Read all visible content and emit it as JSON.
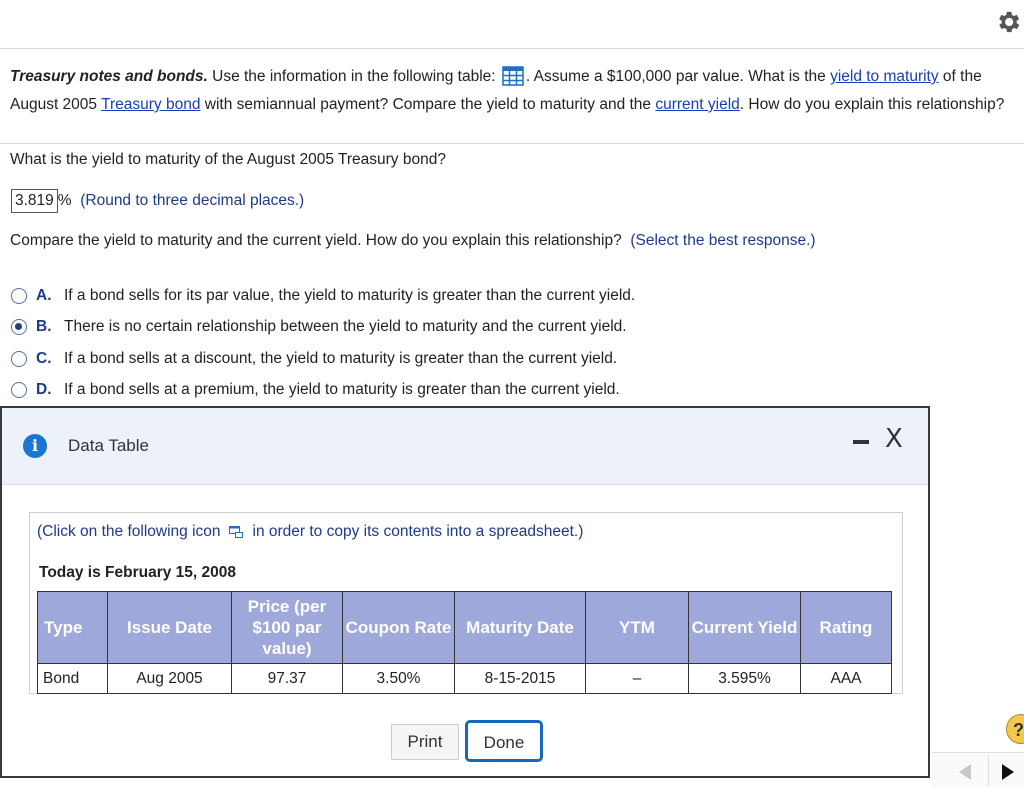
{
  "question": {
    "title": "Treasury notes and bonds.",
    "p1": " Use the information in the following table: ",
    "p2": ". Assume a $100,000 par value. What is the ",
    "link_ytm": "yield to maturity",
    "p3": " of the August 2005 ",
    "link_tbond": "Treasury bond",
    "p4": " with semiannual payment? Compare the yield to maturity and the ",
    "link_cy": "current yield",
    "p5": ". How do you explain this relationship?"
  },
  "part1": {
    "prompt": "What is the yield to maturity of the August 2005 Treasury bond?",
    "answer": "3.819",
    "unit": "%",
    "hint": "(Round to three decimal places.)"
  },
  "part2": {
    "prompt": "Compare the yield to maturity and the current yield.  How do you explain this relationship?",
    "hint": "(Select the best response.)",
    "choices": [
      {
        "letter": "A.",
        "text": "If a bond sells for its par value, the yield to maturity is greater than the current yield."
      },
      {
        "letter": "B.",
        "text": "There is no certain relationship between the yield to maturity and the current yield."
      },
      {
        "letter": "C.",
        "text": "If a bond sells at a discount, the yield to maturity is greater than the current yield."
      },
      {
        "letter": "D.",
        "text": "If a bond sells at a premium, the yield to maturity is greater than the current yield."
      }
    ],
    "selected": "B."
  },
  "modal": {
    "title": "Data Table",
    "minimize": "-",
    "close": "X",
    "copy_pre": "(Click on the following icon",
    "copy_post": "in order to copy its contents into a spreadsheet.)",
    "today": "Today is February 15, 2008",
    "headers": [
      "Type",
      "Issue Date",
      "Price (per $100 par value)",
      "Coupon Rate",
      "Maturity Date",
      "YTM",
      "Current Yield",
      "Rating"
    ],
    "row": [
      "Bond",
      "Aug 2005",
      "97.37",
      "3.50%",
      "8-15-2015",
      "–",
      "3.595%",
      "AAA"
    ],
    "print": "Print",
    "done": "Done"
  },
  "help": "?",
  "icons": {
    "settings": "gear-icon",
    "table": "table-icon",
    "info": "info-icon",
    "copy": "copy-icon"
  }
}
